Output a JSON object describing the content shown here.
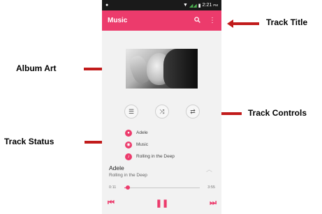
{
  "colors": {
    "accent": "#ec3b6c",
    "arrow": "#c11b1b"
  },
  "status_bar": {
    "time": "2:21",
    "ampm": "PM"
  },
  "app_bar": {
    "title": "Music",
    "icons": [
      "search-icon",
      "overflow-menu-icon"
    ]
  },
  "album_art": {
    "description_icon": "album-art"
  },
  "track_controls": {
    "icons": [
      "queue-list-icon",
      "shuffle-icon",
      "repeat-icon"
    ]
  },
  "track_status": {
    "items": [
      {
        "icon": "artist-icon",
        "label": "Adele"
      },
      {
        "icon": "album-icon",
        "label": "Music"
      },
      {
        "icon": "song-icon",
        "label": "Rolling in the Deep"
      }
    ]
  },
  "now_playing": {
    "artist": "Adele",
    "title": "Rolling in the Deep",
    "elapsed": "0:11",
    "duration": "3:55",
    "progress": 0.05
  },
  "playback": {
    "icons": [
      "previous-icon",
      "pause-icon",
      "next-icon"
    ]
  },
  "annotations": {
    "track_title": "Track Title",
    "album_art": "Album Art",
    "track_controls": "Track Controls",
    "track_status": "Track Status"
  }
}
